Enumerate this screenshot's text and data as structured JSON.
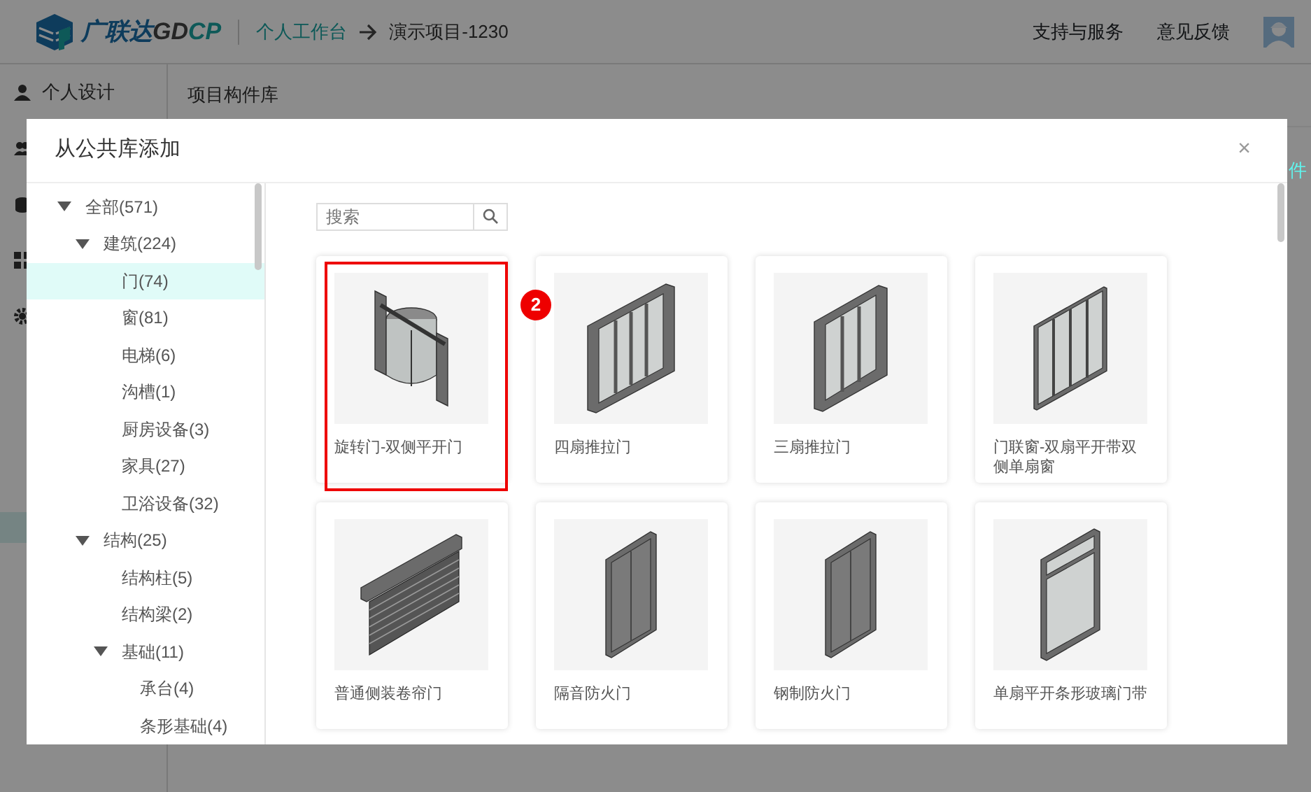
{
  "header": {
    "logo": {
      "brand": "广联达",
      "code_a": "GD",
      "code_b": "CP"
    },
    "breadcrumb": [
      {
        "label": "个人工作台",
        "link": true
      },
      {
        "label": "演示项目-1230",
        "link": false
      }
    ],
    "links": [
      "支持与服务",
      "意见反馈"
    ]
  },
  "sidebar": {
    "label": "个人设计"
  },
  "page": {
    "title": "项目构件库",
    "partial_link": "件"
  },
  "dialog": {
    "title": "从公共库添加",
    "close": "×",
    "tree": [
      {
        "label": "全部(571)",
        "expanded": true,
        "selected": false,
        "children": [
          {
            "label": "建筑(224)",
            "expanded": true,
            "selected": false,
            "children": [
              {
                "label": "门(74)",
                "selected": true
              },
              {
                "label": "窗(81)",
                "selected": false
              },
              {
                "label": "电梯(6)",
                "selected": false
              },
              {
                "label": "沟槽(1)",
                "selected": false
              },
              {
                "label": "厨房设备(3)",
                "selected": false
              },
              {
                "label": "家具(27)",
                "selected": false
              },
              {
                "label": "卫浴设备(32)",
                "selected": false
              }
            ]
          },
          {
            "label": "结构(25)",
            "expanded": true,
            "selected": false,
            "children": [
              {
                "label": "结构柱(5)",
                "selected": false
              },
              {
                "label": "结构梁(2)",
                "selected": false
              },
              {
                "label": "基础(11)",
                "expanded": true,
                "selected": false,
                "children": [
                  {
                    "label": "承台(4)",
                    "selected": false
                  },
                  {
                    "label": "条形基础(4)",
                    "selected": false
                  }
                ]
              }
            ]
          }
        ]
      }
    ],
    "search": {
      "placeholder": "搜索"
    },
    "cards": [
      {
        "name": "旋转门-双侧平开门",
        "kind": "revolving",
        "highlighted": true
      },
      {
        "name": "四扇推拉门",
        "kind": "sliding4",
        "highlighted": false
      },
      {
        "name": "三扇推拉门",
        "kind": "sliding3",
        "highlighted": false
      },
      {
        "name": "门联窗-双扇平开带双侧单扇窗",
        "kind": "sliding4thin",
        "highlighted": false
      },
      {
        "name": "普通侧装卷帘门",
        "kind": "shutter",
        "highlighted": false
      },
      {
        "name": "隔音防火门",
        "kind": "firedoor",
        "highlighted": false
      },
      {
        "name": "钢制防火门",
        "kind": "firedoor",
        "highlighted": false
      },
      {
        "name": "单扇平开条形玻璃门带",
        "kind": "glassdoor",
        "highlighted": false
      }
    ],
    "annotation": {
      "badge": "2"
    }
  }
}
